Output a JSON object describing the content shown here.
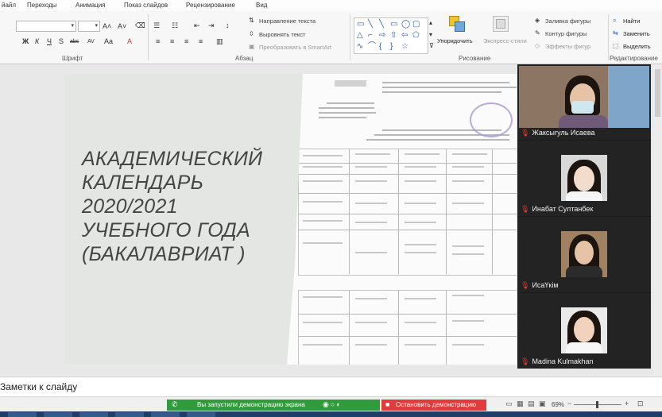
{
  "tabs": [
    "йайл",
    "Переходы",
    "Анимация",
    "Показ слайдов",
    "Рецензирование",
    "Вид"
  ],
  "ribbon": {
    "groups": {
      "font": "Шрифт",
      "paragraph": "Абзац",
      "drawing": "Рисование",
      "editing": "Редактирование"
    },
    "font_buttons": [
      "Ж",
      "К",
      "Ч",
      "S",
      "abc",
      "AV",
      "Aa",
      "A"
    ],
    "paragraph": {
      "text_direction": "Направление текста",
      "align_text": "Выровнять текст",
      "smartart": "Преобразовать в SmartArt"
    },
    "drawing": {
      "arrange": "Упорядочить",
      "quick_styles": "Экспресс-стили",
      "shape_fill": "Заливка фигуры",
      "shape_outline": "Контур фигуры",
      "shape_effects": "Эффекты фигур"
    },
    "editing": {
      "find": "Найти",
      "replace": "Заменить",
      "select": "Выделить"
    }
  },
  "slide": {
    "title": "АКАДЕМИЧЕСКИЙ\nКАЛЕНДАРЬ\n2020/2021\nУЧЕБНОГО ГОДА\n(БАКАЛАВРИАТ )"
  },
  "participants": [
    {
      "name": "Жаксыгуль Исаева"
    },
    {
      "name": "Инабат Султанбек"
    },
    {
      "name": "ИсаҮкім"
    },
    {
      "name": "Madina Kulmakhan"
    }
  ],
  "notes": {
    "label": "Заметки к слайду"
  },
  "status": {
    "sharing_message": "Вы запустили демонстрацию экрана",
    "stop_button": "Остановить демонстрацию",
    "zoom": "69%"
  },
  "colors": {
    "share_green": "#2f9b3a",
    "stop_red": "#e13b3b",
    "muted_mic": "#e0423a"
  },
  "icons": [
    "mic-muted-icon",
    "close-icon",
    "search-icon",
    "chevron-down-icon"
  ]
}
